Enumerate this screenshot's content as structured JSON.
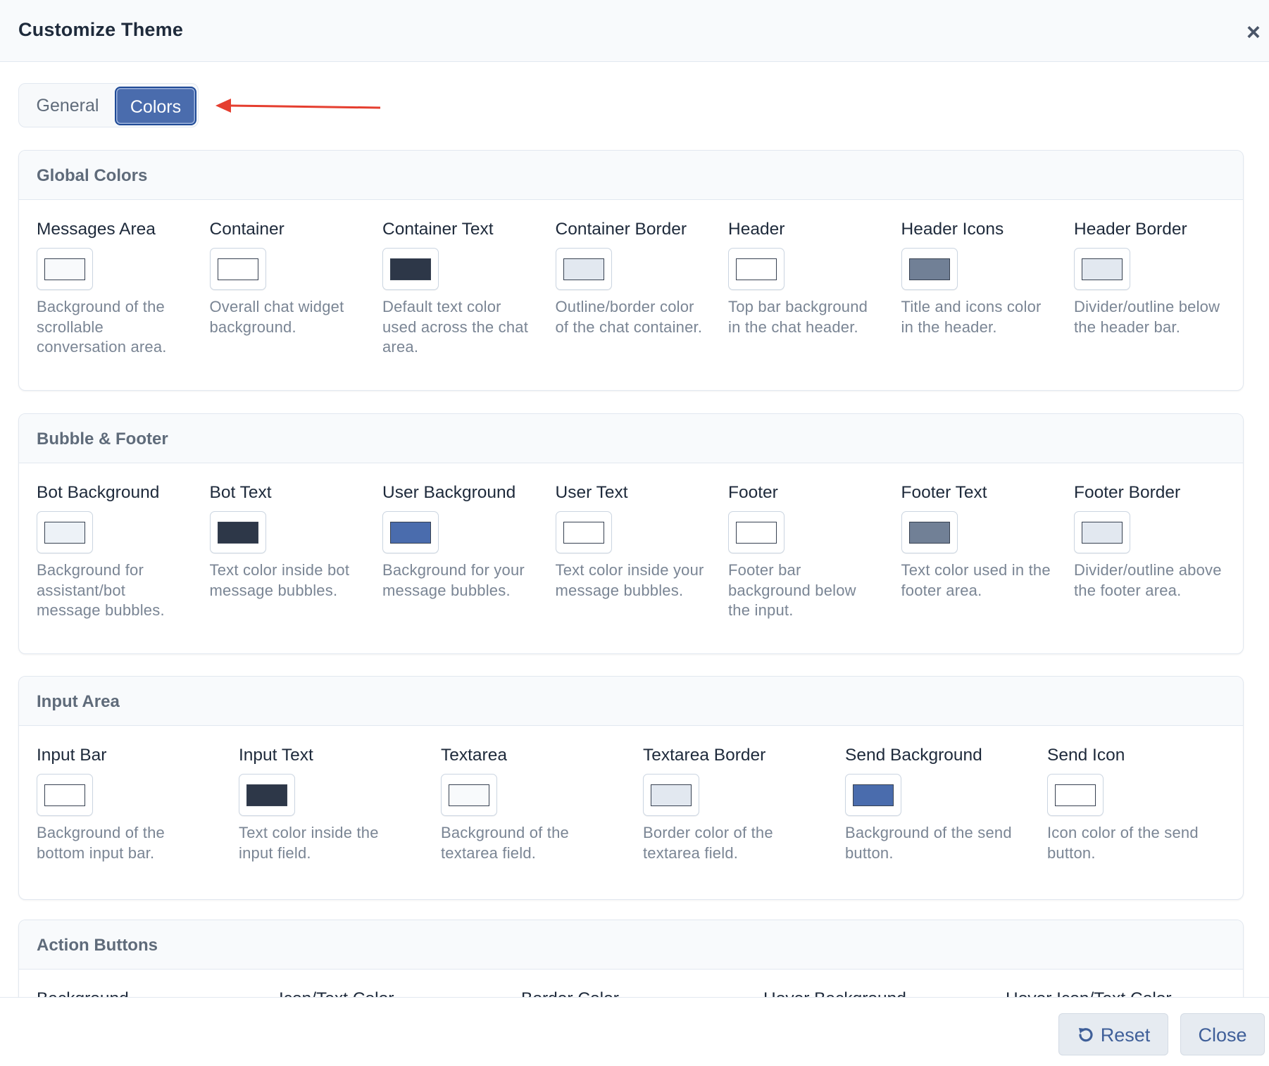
{
  "modal": {
    "title": "Customize Theme",
    "close_glyph": "×",
    "close_icon": "close-icon"
  },
  "tabs": [
    {
      "label": "General",
      "active": false
    },
    {
      "label": "Colors",
      "active": true
    }
  ],
  "colors": {
    "accent": "#4a6cad",
    "annotation_arrow": "#e53e2f"
  },
  "sections": [
    {
      "title": "Global Colors",
      "items": [
        {
          "label": "Messages Area",
          "color": "#f8fafc",
          "desc": "Background of the scrollable conversation area."
        },
        {
          "label": "Container",
          "color": "#ffffff",
          "desc": "Overall chat widget background."
        },
        {
          "label": "Container Text",
          "color": "#2d3748",
          "desc": "Default text color used across the chat area."
        },
        {
          "label": "Container Border",
          "color": "#e2e8f0",
          "desc": "Outline/border color of the chat container."
        },
        {
          "label": "Header",
          "color": "#ffffff",
          "desc": "Top bar background in the chat header."
        },
        {
          "label": "Header Icons",
          "color": "#718096",
          "desc": "Title and icons color in the header."
        },
        {
          "label": "Header Border",
          "color": "#e2e8f0",
          "desc": "Divider/outline below the header bar."
        }
      ]
    },
    {
      "title": "Bubble & Footer",
      "items": [
        {
          "label": "Bot Background",
          "color": "#edf2f7",
          "desc": "Background for assistant/bot message bubbles."
        },
        {
          "label": "Bot Text",
          "color": "#2d3748",
          "desc": "Text color inside bot message bubbles."
        },
        {
          "label": "User Background",
          "color": "#4a6cad",
          "desc": "Background for your message bubbles."
        },
        {
          "label": "User Text",
          "color": "#ffffff",
          "desc": "Text color inside your message bubbles."
        },
        {
          "label": "Footer",
          "color": "#ffffff",
          "desc": "Footer bar background below the input."
        },
        {
          "label": "Footer Text",
          "color": "#718096",
          "desc": "Text color used in the footer area."
        },
        {
          "label": "Footer Border",
          "color": "#e2e8f0",
          "desc": "Divider/outline above the footer area."
        }
      ]
    },
    {
      "title": "Input Area",
      "items": [
        {
          "label": "Input Bar",
          "color": "#ffffff",
          "desc": "Background of the bottom input bar."
        },
        {
          "label": "Input Text",
          "color": "#2d3748",
          "desc": "Text color inside the input field."
        },
        {
          "label": "Textarea",
          "color": "#f8fafc",
          "desc": "Background of the textarea field."
        },
        {
          "label": "Textarea Border",
          "color": "#e2e8f0",
          "desc": "Border color of the textarea field."
        },
        {
          "label": "Send Background",
          "color": "#4a6cad",
          "desc": "Background of the send button."
        },
        {
          "label": "Send Icon",
          "color": "#ffffff",
          "desc": "Icon color of the send button."
        }
      ]
    },
    {
      "title": "Action Buttons",
      "items": [
        {
          "label": "Background"
        },
        {
          "label": "Icon/Text Color"
        },
        {
          "label": "Border Color"
        },
        {
          "label": "Hover Background"
        },
        {
          "label": "Hover Icon/Text Color"
        }
      ]
    }
  ],
  "footer": {
    "reset_label": "Reset",
    "reset_icon": "reset-icon",
    "close_label": "Close"
  }
}
